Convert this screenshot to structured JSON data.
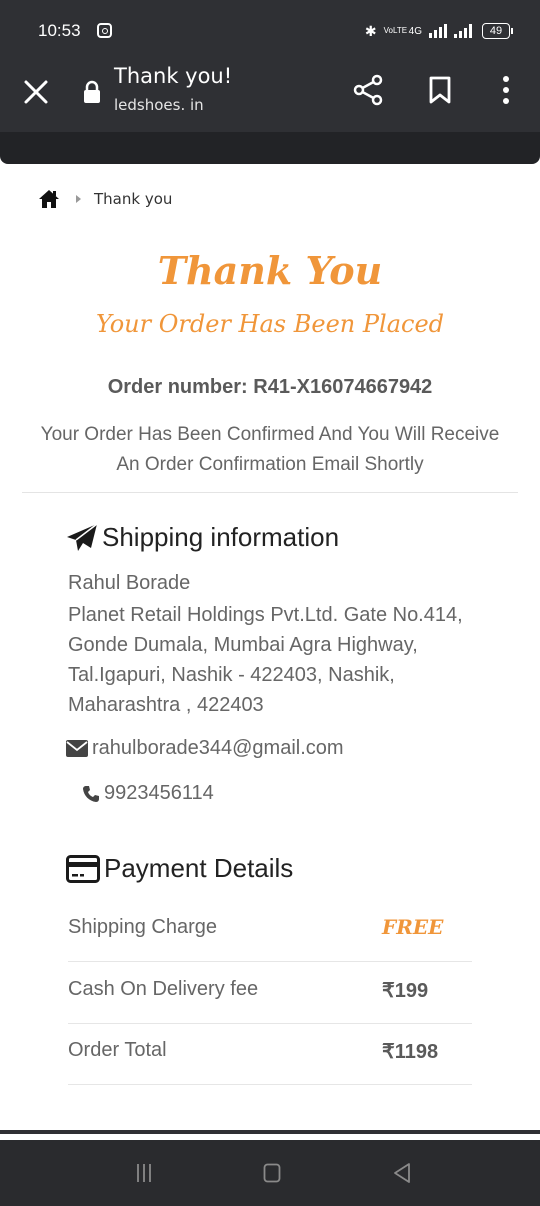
{
  "status_bar": {
    "time": "10:53",
    "network_label": "VoLTE",
    "data_label": "4G",
    "battery": "49"
  },
  "browser": {
    "page_title": "Thank you!",
    "url": "ledshoes. in"
  },
  "breadcrumb": {
    "current": "Thank you"
  },
  "hero": {
    "title": "Thank You",
    "subtitle": "Your Order Has Been Placed",
    "order_number": "Order number: R41-X16074667942",
    "confirmation_message": "Your Order Has Been Confirmed And You Will Receive An Order Confirmation Email Shortly"
  },
  "shipping": {
    "heading": "Shipping information",
    "name": "Rahul Borade",
    "address": "Planet Retail Holdings Pvt.Ltd. Gate No.414, Gonde Dumala, Mumbai Agra Highway, Tal.Igapuri, Nashik - 422403, Nashik, Maharashtra , 422403",
    "email": "rahulborade344@gmail.com",
    "phone": "9923456114"
  },
  "payment": {
    "heading": "Payment Details",
    "rows": [
      {
        "label": "Shipping Charge",
        "value": "FREE"
      },
      {
        "label": "Cash On Delivery fee",
        "value": "₹199"
      },
      {
        "label": "Order Total",
        "value": "₹1198"
      }
    ]
  },
  "colors": {
    "accent": "#f0963a",
    "toolbar": "#2f3034",
    "text": "#666666"
  }
}
